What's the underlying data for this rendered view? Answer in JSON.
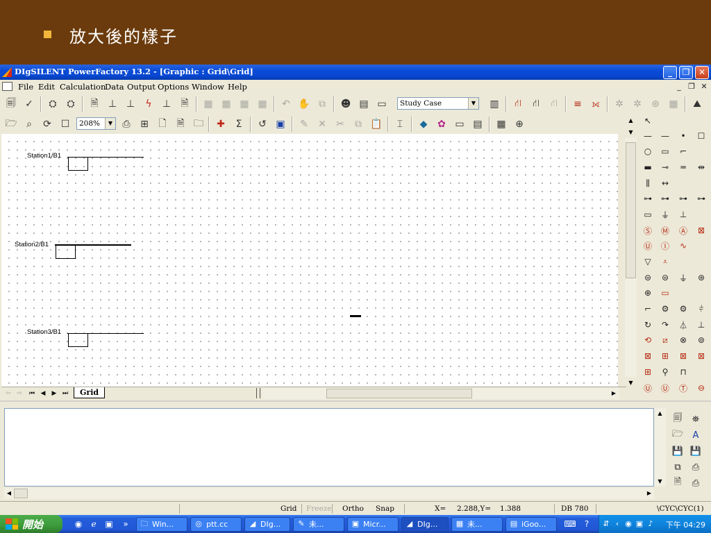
{
  "slide": {
    "title": "放大後的樣子"
  },
  "window": {
    "title": "DIgSILENT PowerFactory 13.2 - [Graphic : Grid\\Grid]"
  },
  "menu": [
    "File",
    "Edit",
    "Calculation",
    "Data",
    "Output",
    "Options",
    "Window",
    "Help"
  ],
  "toolbar": {
    "study_case": "Study Case",
    "zoom": "208%"
  },
  "canvas": {
    "stations": [
      {
        "label": "Station1/B1"
      },
      {
        "label": "Station2/B1"
      },
      {
        "label": "Station3/B1"
      }
    ]
  },
  "tabs": {
    "grid": "Grid"
  },
  "status": {
    "grid": "Grid",
    "freeze": "Freeze",
    "ortho": "Ortho",
    "snap": "Snap",
    "x_label": "X=",
    "coords": "2.288,Y=",
    "y_value": "1.388",
    "db": "DB 780",
    "path": "\\CYC\\CYC(1)"
  },
  "taskbar": {
    "start": "開始",
    "tasks": [
      "Win...",
      "ptt.cc",
      "DIg...",
      "未...",
      "Micr...",
      "DIg...",
      "未...",
      "iGoo..."
    ],
    "clock": "下午 04:29"
  },
  "colors": {
    "banner": "#6b3b0d",
    "titlebar": "#0a4bd6",
    "start": "#3c9a3a",
    "accent_red": "#b52a12"
  }
}
